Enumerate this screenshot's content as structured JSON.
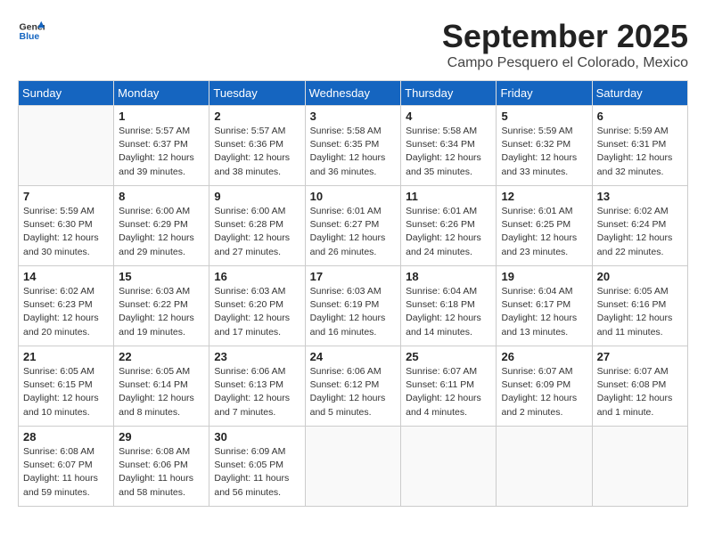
{
  "logo": {
    "general": "General",
    "blue": "Blue"
  },
  "title": "September 2025",
  "subtitle": "Campo Pesquero el Colorado, Mexico",
  "days_of_week": [
    "Sunday",
    "Monday",
    "Tuesday",
    "Wednesday",
    "Thursday",
    "Friday",
    "Saturday"
  ],
  "weeks": [
    [
      {
        "day": "",
        "info": ""
      },
      {
        "day": "1",
        "info": "Sunrise: 5:57 AM\nSunset: 6:37 PM\nDaylight: 12 hours\nand 39 minutes."
      },
      {
        "day": "2",
        "info": "Sunrise: 5:57 AM\nSunset: 6:36 PM\nDaylight: 12 hours\nand 38 minutes."
      },
      {
        "day": "3",
        "info": "Sunrise: 5:58 AM\nSunset: 6:35 PM\nDaylight: 12 hours\nand 36 minutes."
      },
      {
        "day": "4",
        "info": "Sunrise: 5:58 AM\nSunset: 6:34 PM\nDaylight: 12 hours\nand 35 minutes."
      },
      {
        "day": "5",
        "info": "Sunrise: 5:59 AM\nSunset: 6:32 PM\nDaylight: 12 hours\nand 33 minutes."
      },
      {
        "day": "6",
        "info": "Sunrise: 5:59 AM\nSunset: 6:31 PM\nDaylight: 12 hours\nand 32 minutes."
      }
    ],
    [
      {
        "day": "7",
        "info": "Sunrise: 5:59 AM\nSunset: 6:30 PM\nDaylight: 12 hours\nand 30 minutes."
      },
      {
        "day": "8",
        "info": "Sunrise: 6:00 AM\nSunset: 6:29 PM\nDaylight: 12 hours\nand 29 minutes."
      },
      {
        "day": "9",
        "info": "Sunrise: 6:00 AM\nSunset: 6:28 PM\nDaylight: 12 hours\nand 27 minutes."
      },
      {
        "day": "10",
        "info": "Sunrise: 6:01 AM\nSunset: 6:27 PM\nDaylight: 12 hours\nand 26 minutes."
      },
      {
        "day": "11",
        "info": "Sunrise: 6:01 AM\nSunset: 6:26 PM\nDaylight: 12 hours\nand 24 minutes."
      },
      {
        "day": "12",
        "info": "Sunrise: 6:01 AM\nSunset: 6:25 PM\nDaylight: 12 hours\nand 23 minutes."
      },
      {
        "day": "13",
        "info": "Sunrise: 6:02 AM\nSunset: 6:24 PM\nDaylight: 12 hours\nand 22 minutes."
      }
    ],
    [
      {
        "day": "14",
        "info": "Sunrise: 6:02 AM\nSunset: 6:23 PM\nDaylight: 12 hours\nand 20 minutes."
      },
      {
        "day": "15",
        "info": "Sunrise: 6:03 AM\nSunset: 6:22 PM\nDaylight: 12 hours\nand 19 minutes."
      },
      {
        "day": "16",
        "info": "Sunrise: 6:03 AM\nSunset: 6:20 PM\nDaylight: 12 hours\nand 17 minutes."
      },
      {
        "day": "17",
        "info": "Sunrise: 6:03 AM\nSunset: 6:19 PM\nDaylight: 12 hours\nand 16 minutes."
      },
      {
        "day": "18",
        "info": "Sunrise: 6:04 AM\nSunset: 6:18 PM\nDaylight: 12 hours\nand 14 minutes."
      },
      {
        "day": "19",
        "info": "Sunrise: 6:04 AM\nSunset: 6:17 PM\nDaylight: 12 hours\nand 13 minutes."
      },
      {
        "day": "20",
        "info": "Sunrise: 6:05 AM\nSunset: 6:16 PM\nDaylight: 12 hours\nand 11 minutes."
      }
    ],
    [
      {
        "day": "21",
        "info": "Sunrise: 6:05 AM\nSunset: 6:15 PM\nDaylight: 12 hours\nand 10 minutes."
      },
      {
        "day": "22",
        "info": "Sunrise: 6:05 AM\nSunset: 6:14 PM\nDaylight: 12 hours\nand 8 minutes."
      },
      {
        "day": "23",
        "info": "Sunrise: 6:06 AM\nSunset: 6:13 PM\nDaylight: 12 hours\nand 7 minutes."
      },
      {
        "day": "24",
        "info": "Sunrise: 6:06 AM\nSunset: 6:12 PM\nDaylight: 12 hours\nand 5 minutes."
      },
      {
        "day": "25",
        "info": "Sunrise: 6:07 AM\nSunset: 6:11 PM\nDaylight: 12 hours\nand 4 minutes."
      },
      {
        "day": "26",
        "info": "Sunrise: 6:07 AM\nSunset: 6:09 PM\nDaylight: 12 hours\nand 2 minutes."
      },
      {
        "day": "27",
        "info": "Sunrise: 6:07 AM\nSunset: 6:08 PM\nDaylight: 12 hours\nand 1 minute."
      }
    ],
    [
      {
        "day": "28",
        "info": "Sunrise: 6:08 AM\nSunset: 6:07 PM\nDaylight: 11 hours\nand 59 minutes."
      },
      {
        "day": "29",
        "info": "Sunrise: 6:08 AM\nSunset: 6:06 PM\nDaylight: 11 hours\nand 58 minutes."
      },
      {
        "day": "30",
        "info": "Sunrise: 6:09 AM\nSunset: 6:05 PM\nDaylight: 11 hours\nand 56 minutes."
      },
      {
        "day": "",
        "info": ""
      },
      {
        "day": "",
        "info": ""
      },
      {
        "day": "",
        "info": ""
      },
      {
        "day": "",
        "info": ""
      }
    ]
  ]
}
